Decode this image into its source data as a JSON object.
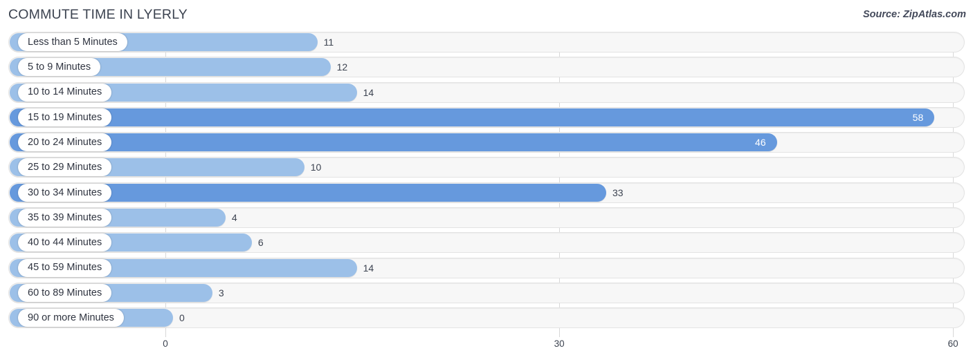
{
  "header": {
    "title": "COMMUTE TIME IN LYERLY",
    "source": "Source: ZipAtlas.com"
  },
  "colors": {
    "bar_light": "#9cc0e8",
    "bar_dark": "#6699dd",
    "track": "#f7f7f7",
    "track_border": "#e3e3e3",
    "gridline": "#d7d7d7",
    "text": "#3c4350",
    "value_inside": "#ffffff"
  },
  "axis": {
    "ticks": [
      {
        "label": "0",
        "value": 0
      },
      {
        "label": "30",
        "value": 30
      },
      {
        "label": "60",
        "value": 60
      }
    ],
    "min": 0,
    "max": 60
  },
  "chart_data": {
    "type": "bar",
    "orientation": "horizontal",
    "title": "COMMUTE TIME IN LYERLY",
    "subtitle": "",
    "xlabel": "",
    "ylabel": "",
    "xlim": [
      0,
      60
    ],
    "grid": true,
    "legend": null,
    "source": "Source: ZipAtlas.com",
    "categories": [
      "Less than 5 Minutes",
      "5 to 9 Minutes",
      "10 to 14 Minutes",
      "15 to 19 Minutes",
      "20 to 24 Minutes",
      "25 to 29 Minutes",
      "30 to 34 Minutes",
      "35 to 39 Minutes",
      "40 to 44 Minutes",
      "45 to 59 Minutes",
      "60 to 89 Minutes",
      "90 or more Minutes"
    ],
    "values": [
      11,
      12,
      14,
      58,
      46,
      10,
      33,
      4,
      6,
      14,
      3,
      0
    ],
    "value_labels": [
      "11",
      "12",
      "14",
      "58",
      "46",
      "10",
      "33",
      "4",
      "6",
      "14",
      "3",
      "0"
    ],
    "bar_shades": [
      "light",
      "light",
      "light",
      "dark",
      "dark",
      "light",
      "dark",
      "light",
      "light",
      "light",
      "light",
      "light"
    ],
    "label_inside_bar": [
      false,
      false,
      false,
      true,
      true,
      false,
      false,
      false,
      false,
      false,
      false,
      false
    ]
  }
}
